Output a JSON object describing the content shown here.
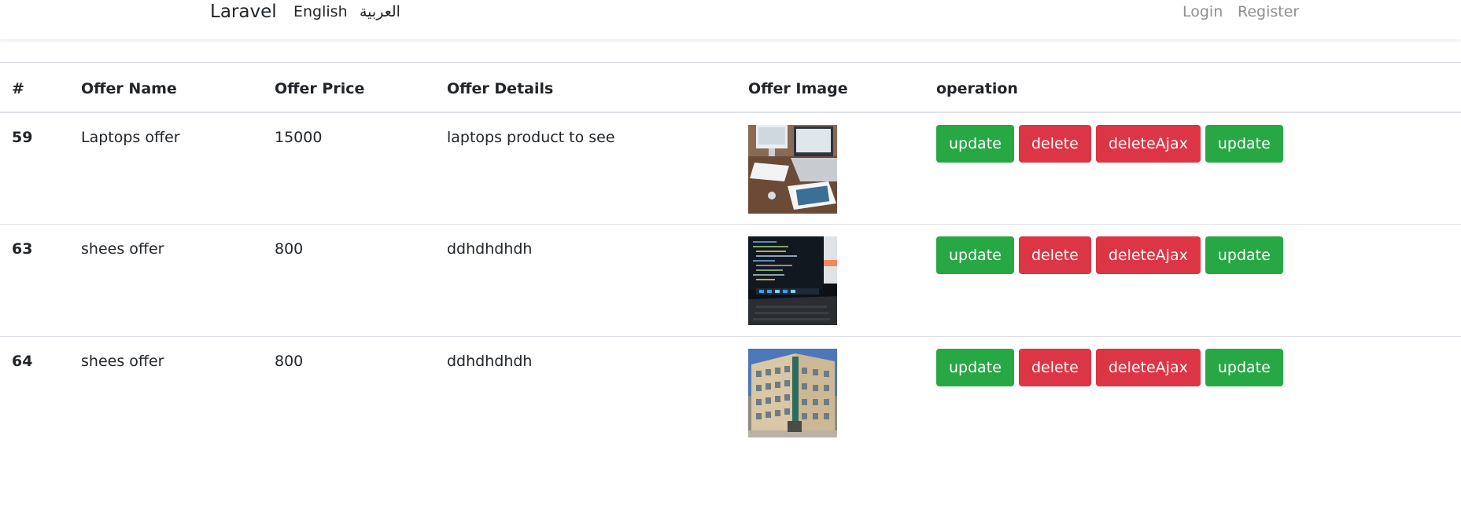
{
  "navbar": {
    "brand": "Laravel",
    "lang_en": "English",
    "lang_ar": "العربية",
    "login": "Login",
    "register": "Register"
  },
  "table": {
    "headers": [
      "#",
      "Offer Name",
      "Offer Price",
      "Offer Details",
      "Offer Image",
      "operation"
    ],
    "rows": [
      {
        "id": "59",
        "name": "Laptops offer",
        "price": "15000",
        "details": "laptops product to see",
        "image": "laptop-desk-photo"
      },
      {
        "id": "63",
        "name": "shees offer",
        "price": "800",
        "details": "ddhdhdhdh",
        "image": "laptop-code-photo"
      },
      {
        "id": "64",
        "name": "shees offer",
        "price": "800",
        "details": "ddhdhdhdh",
        "image": "building-photo"
      }
    ],
    "buttons": {
      "update": "update",
      "delete": "delete",
      "delete_ajax": "deleteAjax",
      "update2": "update"
    }
  },
  "colors": {
    "success": "#28a745",
    "danger": "#dc3545",
    "nav_muted": "#8c8f93"
  }
}
